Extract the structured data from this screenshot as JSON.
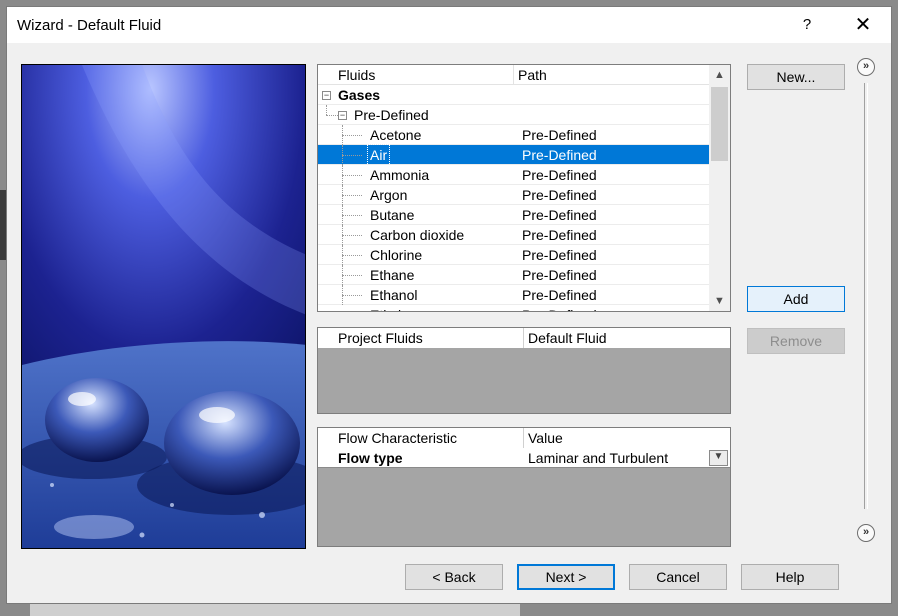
{
  "window": {
    "title": "Wizard - Default Fluid",
    "help_label": "?",
    "close_label": "✕"
  },
  "fluids_tree": {
    "col_fluids": "Fluids",
    "col_path": "Path",
    "group_label": "Gases",
    "subgroup_label": "Pre-Defined",
    "items": [
      {
        "name": "Acetone",
        "path": "Pre-Defined"
      },
      {
        "name": "Air",
        "path": "Pre-Defined",
        "selected": true
      },
      {
        "name": "Ammonia",
        "path": "Pre-Defined"
      },
      {
        "name": "Argon",
        "path": "Pre-Defined"
      },
      {
        "name": "Butane",
        "path": "Pre-Defined"
      },
      {
        "name": "Carbon dioxide",
        "path": "Pre-Defined"
      },
      {
        "name": "Chlorine",
        "path": "Pre-Defined"
      },
      {
        "name": "Ethane",
        "path": "Pre-Defined"
      },
      {
        "name": "Ethanol",
        "path": "Pre-Defined"
      }
    ],
    "partial_row": {
      "name": "Ethyl...",
      "path": "Pre-Defined"
    }
  },
  "project_fluids": {
    "col_fluid": "Project Fluids",
    "col_default": "Default Fluid"
  },
  "flow": {
    "col_characteristic": "Flow Characteristic",
    "col_value": "Value",
    "row_label": "Flow type",
    "row_value": "Laminar and Turbulent"
  },
  "side_buttons": {
    "new": "New...",
    "add": "Add",
    "remove": "Remove"
  },
  "footer": {
    "back": "< Back",
    "next": "Next >",
    "cancel": "Cancel",
    "help": "Help"
  },
  "icons": {
    "expand_collapse": "»",
    "collapse": "−",
    "scroll_up": "▲",
    "scroll_down": "▼",
    "dropdown": "▼"
  },
  "colors": {
    "selection": "#0078d7",
    "empty_panel": "#a5a5a5"
  }
}
